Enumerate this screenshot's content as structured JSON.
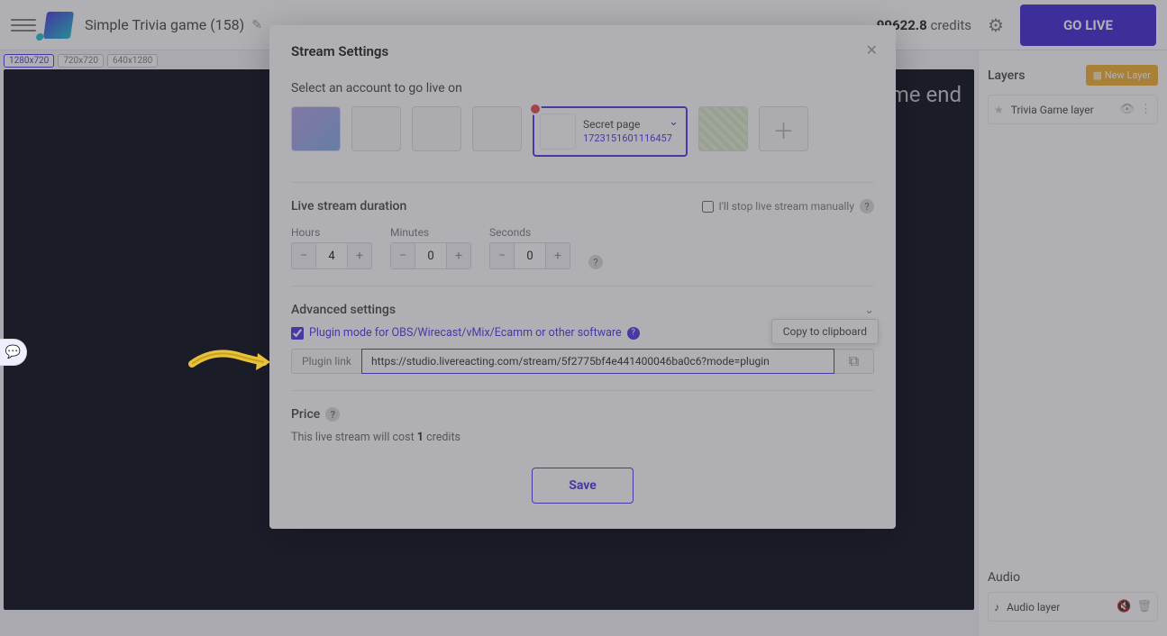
{
  "header": {
    "project_title": "Simple Trivia game (158)",
    "credits_value": "99622.8",
    "credits_label": "credits",
    "golive": "GO LIVE"
  },
  "resolutions": {
    "r1": "1280x720",
    "r2": "720x720",
    "r3": "640x1280"
  },
  "canvas": {
    "label_tail": "me end"
  },
  "right": {
    "layers_title": "Layers",
    "new_layer": "New Layer",
    "layer1": "Trivia Game layer",
    "audio_title": "Audio",
    "audio1": "Audio layer"
  },
  "modal": {
    "title": "Stream Settings",
    "select_account": "Select an account to go live on",
    "selected_name": "Secret page",
    "selected_id": "1723151601116457",
    "duration_label": "Live stream duration",
    "manual_label": "I'll stop live stream manually",
    "hours_cap": "Hours",
    "minutes_cap": "Minutes",
    "seconds_cap": "Seconds",
    "hours_val": "4",
    "minutes_val": "0",
    "seconds_val": "0",
    "advanced_label": "Advanced settings",
    "plugin_mode_label": "Plugin mode for OBS/Wirecast/vMix/Ecamm or other software",
    "plugin_link_label": "Plugin link",
    "plugin_link_value": "https://studio.livereacting.com/stream/5f2775bf4e441400046ba0c6?mode=plugin",
    "tooltip": "Copy to clipboard",
    "price_label": "Price",
    "price_desc_pre": "This live stream will cost ",
    "price_desc_val": "1",
    "price_desc_post": " credits",
    "save": "Save"
  }
}
